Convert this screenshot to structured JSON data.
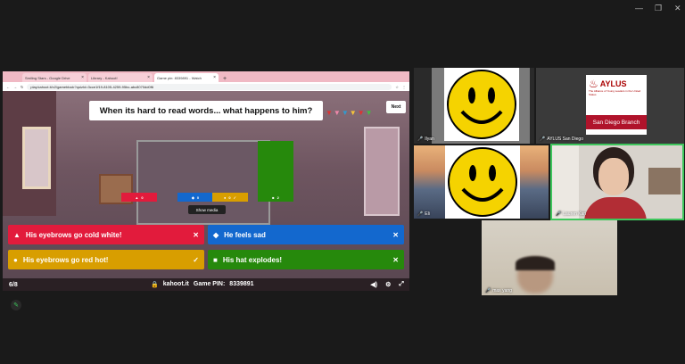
{
  "window_controls": [
    "—",
    "❐",
    "✕"
  ],
  "browser": {
    "tabs": [
      {
        "label": "Smiling Stars - Google Drive",
        "active": false
      },
      {
        "label": "Library - Kahoot!",
        "active": false
      },
      {
        "label": "Game pin: 8339891 - Watch",
        "active": true
      }
    ],
    "url": "play.kahoot.it/v2/gameblock?quizId=3cce1f19-8105-4259-95bc-abc8070dd0f6"
  },
  "kahoot": {
    "question": "When its hard to read words... what happens to him?",
    "next_label": "Next",
    "results": [
      {
        "shape": "▲",
        "count": "0",
        "color": "#e21b3c",
        "value": 0
      },
      {
        "shape": "◆",
        "count": "0",
        "color": "#1368ce",
        "value": 0
      },
      {
        "shape": "●",
        "count": "0",
        "check": "✓",
        "color": "#d89e00",
        "value": 0
      },
      {
        "shape": "■",
        "count": "2",
        "color": "#26890c",
        "value": 2
      }
    ],
    "tooltip": "Show media",
    "answers": [
      {
        "shape": "▲",
        "text": "His eyebrows go cold white!",
        "mark": "✕",
        "color": "#e21b3c"
      },
      {
        "shape": "◆",
        "text": "He feels sad",
        "mark": "✕",
        "color": "#1368ce"
      },
      {
        "shape": "●",
        "text": "His eyebrows go red hot!",
        "mark": "✓",
        "color": "#d89e00"
      },
      {
        "shape": "■",
        "text": "His hat explodes!",
        "mark": "✕",
        "color": "#26890c"
      }
    ],
    "progress": "6/8",
    "site": "kahoot.it",
    "pin_label": "Game PIN:",
    "pin": "8339891"
  },
  "participants": [
    {
      "name": "Ilyan"
    },
    {
      "name": "AYLUS San Diego"
    },
    {
      "name": "Eli"
    },
    {
      "name": "Lauren Kan"
    },
    {
      "name": "max yang"
    }
  ],
  "aylus": {
    "title": "AYLUS",
    "subtitle": "The Alliance of Young Leaders in the United States",
    "branch": "San Diego Branch"
  }
}
